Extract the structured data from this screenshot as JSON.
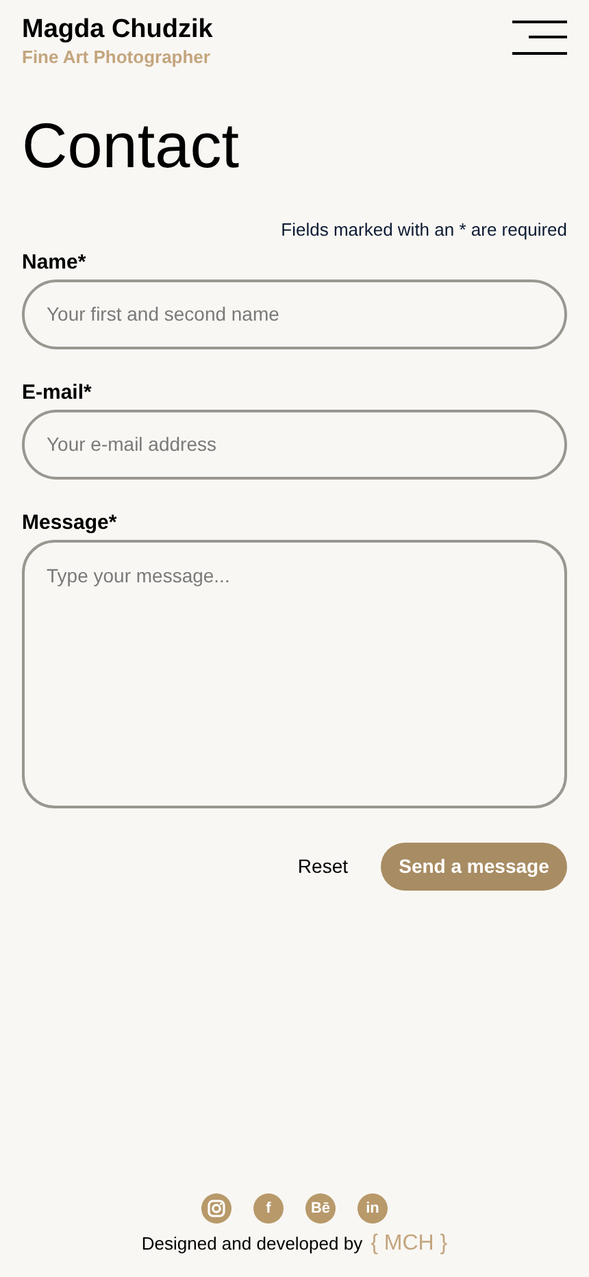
{
  "header": {
    "name": "Magda Chudzik",
    "subtitle": "Fine Art Photographer"
  },
  "title": "Contact",
  "required_note": "Fields marked with an * are required",
  "fields": [
    {
      "kind": "input",
      "label": "Name*",
      "placeholder": "Your first and second name"
    },
    {
      "kind": "input",
      "label": "E-mail*",
      "placeholder": "Your e-mail address"
    },
    {
      "kind": "textarea",
      "label": "Message*",
      "placeholder": "Type your message..."
    }
  ],
  "buttons": [
    {
      "kind": "plain",
      "label": "Reset",
      "disabled": false
    },
    {
      "kind": "filled",
      "label": "Send a message",
      "disabled": true
    }
  ],
  "footer": {
    "social": [
      {
        "kind": "camera"
      },
      {
        "kind": "glyph",
        "text": "f"
      },
      {
        "kind": "glyph",
        "text": "Bē"
      },
      {
        "kind": "glyph",
        "text": "in"
      }
    ],
    "credit": "Designed and developed by",
    "brand": "{ MCH }"
  }
}
